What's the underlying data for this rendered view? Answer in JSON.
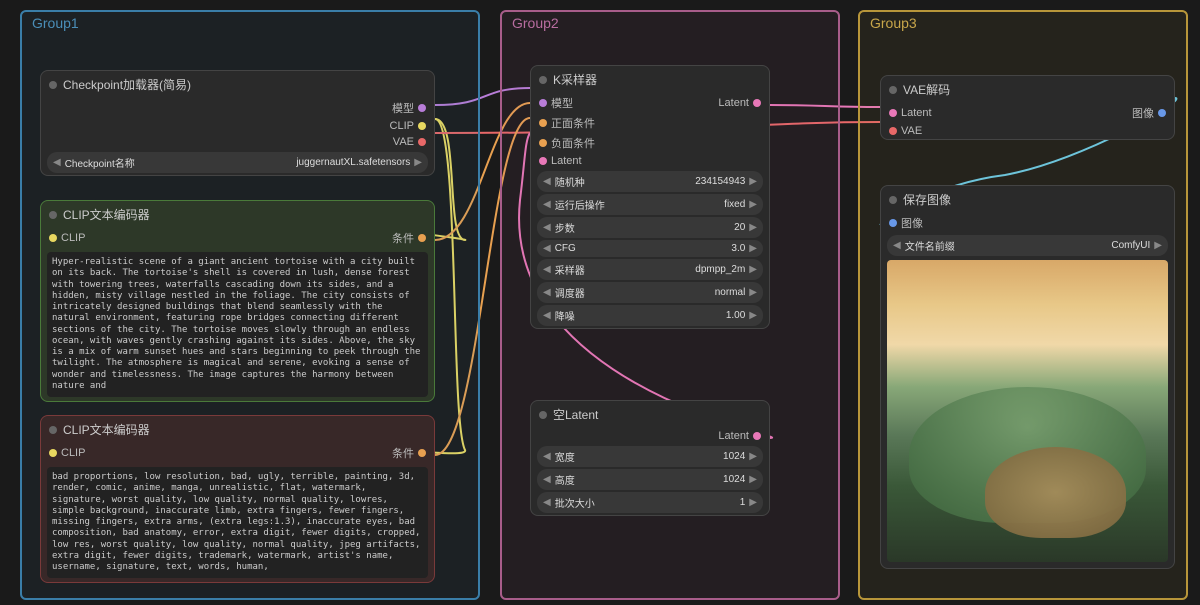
{
  "groups": {
    "g1": "Group1",
    "g2": "Group2",
    "g3": "Group3"
  },
  "checkpoint": {
    "title": "Checkpoint加载器(简易)",
    "out_model": "模型",
    "out_clip": "CLIP",
    "out_vae": "VAE",
    "param_label": "Checkpoint名称",
    "param_value": "juggernautXL.safetensors"
  },
  "clip_pos": {
    "title": "CLIP文本编码器",
    "in_clip": "CLIP",
    "out_cond": "条件",
    "text": "Hyper-realistic scene of a giant ancient tortoise with a city built on its back. The tortoise's shell is covered in lush, dense forest with towering trees, waterfalls cascading down its sides, and a hidden, misty village nestled in the foliage. The city consists of intricately designed buildings that blend seamlessly with the natural environment, featuring rope bridges connecting different sections of the city. The tortoise moves slowly through an endless ocean, with waves gently crashing against its sides. Above, the sky is a mix of warm sunset hues and stars beginning to peek through the twilight. The atmosphere is magical and serene, evoking a sense of wonder and timelessness. The image captures the harmony between nature and"
  },
  "clip_neg": {
    "title": "CLIP文本编码器",
    "in_clip": "CLIP",
    "out_cond": "条件",
    "text": "bad proportions, low resolution, bad, ugly, terrible, painting, 3d, render, comic, anime, manga, unrealistic, flat, watermark, signature, worst quality, low quality, normal quality, lowres, simple background, inaccurate limb, extra fingers, fewer fingers, missing fingers, extra arms, (extra legs:1.3), inaccurate eyes, bad composition, bad anatomy, error, extra digit, fewer digits, cropped, low res, worst quality, low quality, normal quality, jpeg artifacts, extra digit, fewer digits, trademark, watermark, artist's name, username, signature, text, words, human,"
  },
  "ksampler": {
    "title": "K采样器",
    "in_model": "模型",
    "in_pos": "正面条件",
    "in_neg": "负面条件",
    "in_latent": "Latent",
    "out_latent": "Latent",
    "params": [
      {
        "label": "随机种",
        "value": "234154943"
      },
      {
        "label": "运行后操作",
        "value": "fixed"
      },
      {
        "label": "步数",
        "value": "20"
      },
      {
        "label": "CFG",
        "value": "3.0"
      },
      {
        "label": "采样器",
        "value": "dpmpp_2m"
      },
      {
        "label": "调度器",
        "value": "normal"
      },
      {
        "label": "降噪",
        "value": "1.00"
      }
    ]
  },
  "empty_latent": {
    "title": "空Latent",
    "out_latent": "Latent",
    "params": [
      {
        "label": "宽度",
        "value": "1024"
      },
      {
        "label": "高度",
        "value": "1024"
      },
      {
        "label": "批次大小",
        "value": "1"
      }
    ]
  },
  "vae_decode": {
    "title": "VAE解码",
    "in_latent": "Latent",
    "in_vae": "VAE",
    "out_image": "图像"
  },
  "save": {
    "title": "保存图像",
    "in_image": "图像",
    "param_label": "文件名前缀",
    "param_value": "ComfyUI"
  }
}
